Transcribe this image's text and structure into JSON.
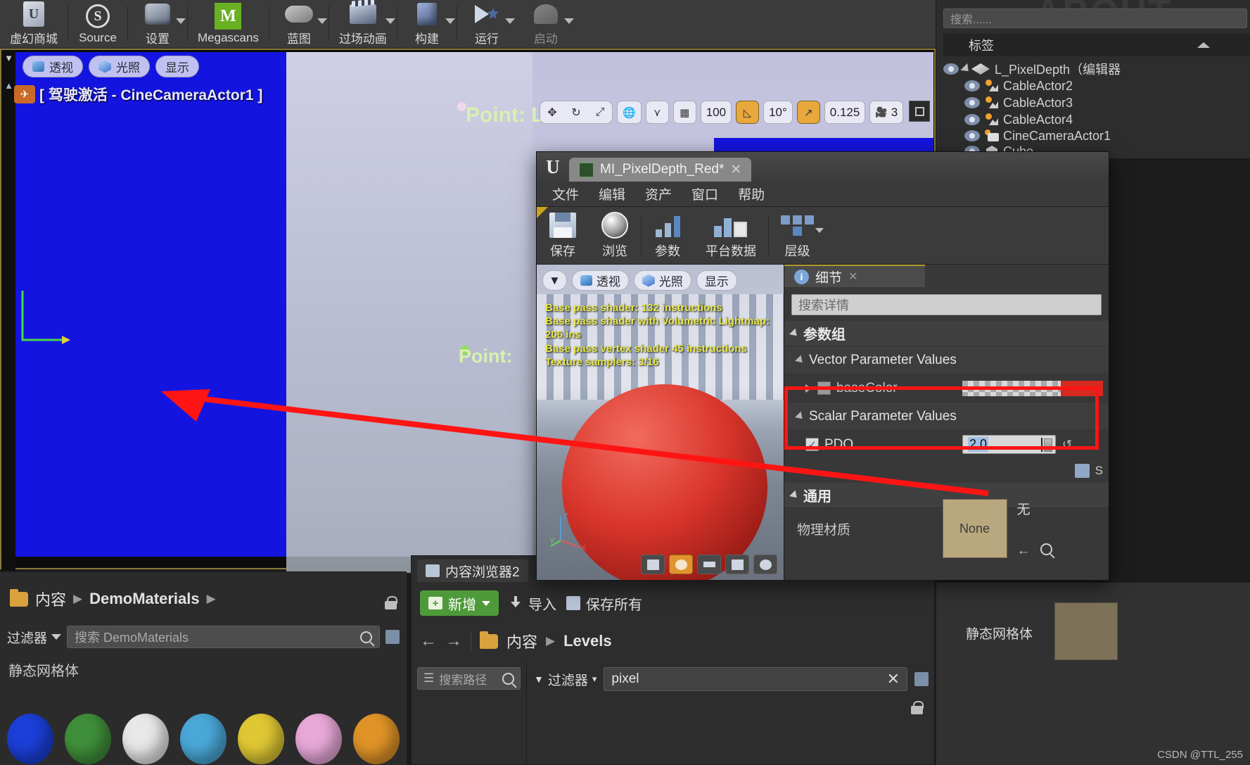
{
  "editor": {
    "toolbar": [
      {
        "label": "虚幻商城",
        "icon": "marketplace-icon",
        "caret": false
      },
      {
        "label": "Source",
        "icon": "source-control-icon",
        "caret": false
      },
      {
        "label": "设置",
        "icon": "settings-icon",
        "caret": true
      },
      {
        "label": "Megascans",
        "icon": "megascans-icon",
        "caret": false
      },
      {
        "label": "蓝图",
        "icon": "blueprint-icon",
        "caret": true
      },
      {
        "label": "过场动画",
        "icon": "cinematics-icon",
        "caret": true
      },
      {
        "label": "构建",
        "icon": "build-icon",
        "caret": true
      },
      {
        "label": "运行",
        "icon": "play-icon",
        "caret": true
      },
      {
        "label": "启动",
        "icon": "launch-icon",
        "caret": true
      }
    ]
  },
  "viewport": {
    "chips": [
      {
        "label": "透视",
        "icon": "perspective-icon"
      },
      {
        "label": "光照",
        "icon": "lit-icon"
      },
      {
        "label": "显示",
        "icon": "show-icon"
      }
    ],
    "drive_label": "[ 驾驶激活 - CineCameraActor1 ]",
    "point_labels": [
      "Point: L",
      "Point:"
    ],
    "tools": {
      "move": "move-gizmo",
      "rotate": "rotate-gizmo",
      "scale": "scale-gizmo",
      "coord_space": "world-space-icon",
      "surface_snap": "surface-snap-icon",
      "grid_snap": "grid-snap-icon",
      "grid_value": "100",
      "angle_snap": "angle-snap-icon",
      "angle_value": "10°",
      "scale_snap": "scale-snap-icon",
      "scale_value": "0.125",
      "camera_icon": "camera-speed-icon",
      "camera_value": "3",
      "maximize": "maximize-viewport-icon"
    }
  },
  "outliner": {
    "ghost_text": "ABOUT",
    "search_placeholder": "搜索......",
    "column_header": "标签",
    "items": [
      {
        "label": "L_PixelDepth（编辑器",
        "icon": "level-icon",
        "indent": 0,
        "expandable": true
      },
      {
        "label": "CableActor2",
        "icon": "cable-actor-icon",
        "indent": 1,
        "expandable": false
      },
      {
        "label": "CableActor3",
        "icon": "cable-actor-icon",
        "indent": 1,
        "expandable": false
      },
      {
        "label": "CableActor4",
        "icon": "cable-actor-icon",
        "indent": 1,
        "expandable": false
      },
      {
        "label": "CineCameraActor1",
        "icon": "cine-camera-icon",
        "indent": 1,
        "expandable": false
      },
      {
        "label": "Cube",
        "icon": "cube-icon",
        "indent": 1,
        "expandable": false
      }
    ]
  },
  "content_browser_left": {
    "breadcrumbs": [
      "内容",
      "DemoMaterials"
    ],
    "filter_label": "过滤器",
    "search_placeholder": "搜索 DemoMaterials",
    "section_label": "静态网格体",
    "assets": [
      "#1b3fd8",
      "#3f8f3a",
      "#e8e8e8",
      "#4aa8d8",
      "#e0c834",
      "#e8a8d8",
      "#e09428"
    ]
  },
  "content_browser_mid": {
    "tab_label": "内容浏览器2",
    "add_label": "新增",
    "import_label": "导入",
    "save_all_label": "保存所有",
    "breadcrumbs": [
      "内容",
      "Levels"
    ],
    "tree_search_placeholder": "搜索路径",
    "filter_label": "过滤器",
    "filter_value": "pixel"
  },
  "bottom_right": {
    "label": "静态网格体"
  },
  "material_editor": {
    "tab_title": "MI_PixelDepth_Red*",
    "menu": [
      "文件",
      "编辑",
      "资产",
      "窗口",
      "帮助"
    ],
    "toolbar": [
      {
        "label": "保存",
        "icon": "save-icon",
        "caret": false
      },
      {
        "label": "浏览",
        "icon": "browse-icon",
        "caret": false
      },
      {
        "label": "参数",
        "icon": "parameters-icon",
        "caret": false
      },
      {
        "label": "平台数据",
        "icon": "platform-stats-icon",
        "caret": false
      },
      {
        "label": "层级",
        "icon": "hierarchy-icon",
        "caret": true
      }
    ],
    "viewport": {
      "chips": [
        {
          "label": "透视",
          "icon": "perspective-icon"
        },
        {
          "label": "光照",
          "icon": "lit-icon"
        },
        {
          "label": "显示",
          "icon": "show-icon"
        }
      ],
      "stats": [
        "Base pass shader: 132 instructions",
        "Base pass shader with Volumetric Lightmap: 206 ins",
        "Base pass vertex shader 45 instructions",
        "Texture samplers: 3/16"
      ],
      "axis_labels": [
        "Z",
        "Y",
        "X"
      ]
    },
    "details": {
      "tab_label": "细节",
      "search_placeholder": "搜索详情",
      "sections": [
        {
          "label": "参数组",
          "level": 0
        },
        {
          "label": "Vector Parameter Values",
          "level": 1
        },
        {
          "label": "Scalar Parameter Values",
          "level": 1
        }
      ],
      "vector_param": {
        "name": "baseColor",
        "swatch_color": "#d42a20"
      },
      "scalar_param": {
        "name": "PDO",
        "value": "2.0",
        "checked": true
      },
      "general_section": "通用",
      "physical_material_label": "物理材质",
      "physical_material_value": "None",
      "physical_material_none": "无"
    }
  },
  "watermark": "CSDN @TTL_255",
  "colors": {
    "accent_orange": "#e8a83c",
    "highlight_red": "#ff1414",
    "green_add": "#4e9a3a",
    "viewport_blue": "#1414e0"
  }
}
